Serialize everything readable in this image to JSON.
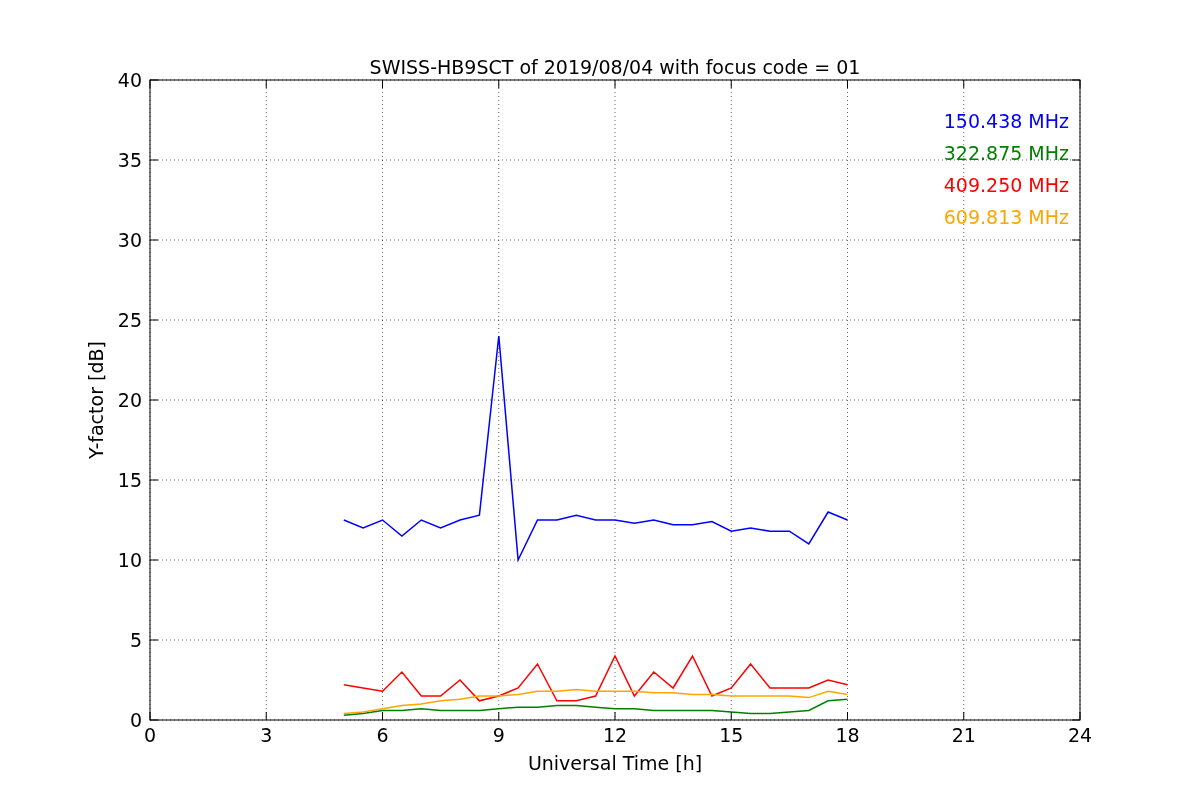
{
  "figure": {
    "chart_data": {
      "type": "line",
      "grid": true,
      "title": "SWISS-HB9SCT of 2019/08/04 with focus code = 01",
      "xlabel": "Universal Time [h]",
      "ylabel": "Y-factor [dB]",
      "xlim": [
        0,
        24
      ],
      "ylim": [
        0,
        40
      ],
      "xticks": [
        0,
        3,
        6,
        9,
        12,
        15,
        18,
        21,
        24
      ],
      "yticks": [
        0,
        5,
        10,
        15,
        20,
        25,
        30,
        35,
        40
      ],
      "x": [
        5,
        5.5,
        6,
        6.5,
        7,
        7.5,
        8,
        8.5,
        9,
        9.5,
        10,
        10.5,
        11,
        11.5,
        12,
        12.5,
        13,
        13.5,
        14,
        14.5,
        15,
        15.5,
        16,
        16.5,
        17,
        17.5,
        18
      ],
      "series": [
        {
          "name": "150.438 MHz",
          "color": "#0000ff",
          "values": [
            12.5,
            12,
            12.5,
            11.5,
            12.5,
            12,
            12.5,
            12.8,
            24,
            10,
            12.5,
            12.5,
            12.8,
            12.5,
            12.5,
            12.3,
            12.5,
            12.2,
            12.2,
            12.4,
            11.8,
            12,
            11.8,
            11.8,
            11,
            13,
            12.5
          ]
        },
        {
          "name": "322.875 MHz",
          "color": "#008000",
          "values": [
            0.3,
            0.4,
            0.6,
            0.6,
            0.7,
            0.6,
            0.6,
            0.6,
            0.7,
            0.8,
            0.8,
            0.9,
            0.9,
            0.8,
            0.7,
            0.7,
            0.6,
            0.6,
            0.6,
            0.6,
            0.5,
            0.4,
            0.4,
            0.5,
            0.6,
            1.2,
            1.3
          ]
        },
        {
          "name": "409.250 MHz",
          "color": "#ff0000",
          "values": [
            2.2,
            2,
            1.8,
            3,
            1.5,
            1.5,
            2.5,
            1.2,
            1.5,
            2,
            3.5,
            1.2,
            1.2,
            1.5,
            4,
            1.5,
            3,
            2,
            4,
            1.5,
            2,
            3.5,
            2,
            2,
            2,
            2.5,
            2.2
          ]
        },
        {
          "name": "609.813 MHz",
          "color": "#ffa500",
          "values": [
            0.4,
            0.5,
            0.7,
            0.9,
            1,
            1.2,
            1.3,
            1.5,
            1.5,
            1.6,
            1.8,
            1.8,
            1.9,
            1.8,
            1.8,
            1.8,
            1.7,
            1.7,
            1.6,
            1.6,
            1.5,
            1.5,
            1.5,
            1.5,
            1.4,
            1.8,
            1.6
          ]
        }
      ]
    }
  }
}
